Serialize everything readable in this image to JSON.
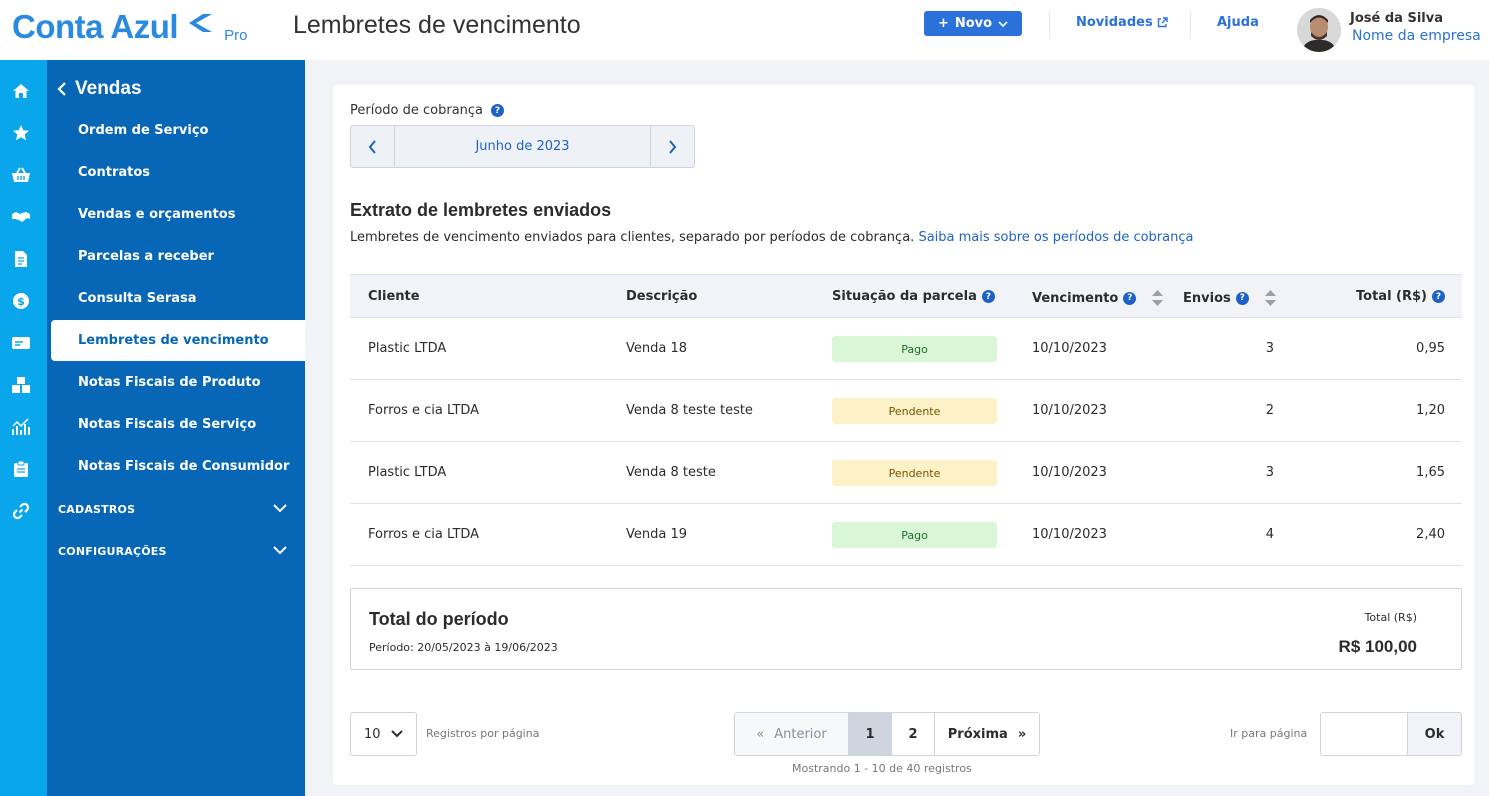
{
  "brand": {
    "name": "Conta Azul",
    "tier": "Pro"
  },
  "header": {
    "title": "Lembretes de vencimento",
    "new_button": "Novo",
    "news_link": "Novidades",
    "help_link": "Ajuda",
    "user_name": "José da Silva",
    "company_name": "Nome da empresa"
  },
  "rail": {
    "icons": [
      "home-icon",
      "star-icon",
      "basket-icon",
      "handshake-icon",
      "document-icon",
      "dollar-icon",
      "card-icon",
      "boxes-icon",
      "chart-icon",
      "clipboard-icon",
      "link-icon"
    ]
  },
  "sidebar": {
    "back_label": "Vendas",
    "items": [
      "Ordem de Serviço",
      "Contratos",
      "Vendas e orçamentos",
      "Parcelas a receber",
      "Consulta Serasa",
      "Lembretes de vencimento",
      "Notas Fiscais de Produto",
      "Notas Fiscais de Serviço",
      "Notas Fiscais de Consumidor"
    ],
    "active_index": 5,
    "sections": [
      "CADASTROS",
      "CONFIGURAÇÕES"
    ]
  },
  "period": {
    "label": "Período de cobrança",
    "value": "Junho de 2023"
  },
  "statement": {
    "title": "Extrato de lembretes enviados",
    "description": "Lembretes de vencimento enviados para clientes, separado por períodos de cobrança.",
    "link": "Saiba mais sobre os períodos de cobrança"
  },
  "table": {
    "columns": [
      "Cliente",
      "Descrição",
      "Situação da parcela",
      "Vencimento",
      "Envios",
      "Total (R$)"
    ],
    "rows": [
      {
        "cliente": "Plastic LTDA",
        "descricao": "Venda 18",
        "situacao": "Pago",
        "vencimento": "10/10/2023",
        "envios": "3",
        "total": "0,95"
      },
      {
        "cliente": "Forros e cia LTDA",
        "descricao": "Venda 8 teste teste",
        "situacao": "Pendente",
        "vencimento": "10/10/2023",
        "envios": "2",
        "total": "1,20"
      },
      {
        "cliente": "Plastic LTDA",
        "descricao": "Venda 8 teste",
        "situacao": "Pendente",
        "vencimento": "10/10/2023",
        "envios": "3",
        "total": "1,65"
      },
      {
        "cliente": "Forros e cia LTDA",
        "descricao": "Venda 19",
        "situacao": "Pago",
        "vencimento": "10/10/2023",
        "envios": "4",
        "total": "2,40"
      }
    ]
  },
  "total": {
    "title": "Total do período",
    "period": "Período: 20/05/2023 à 19/06/2023",
    "label": "Total (R$)",
    "value": "R$ 100,00"
  },
  "pagination": {
    "per_page": "10",
    "per_page_label": "Registros por página",
    "prev": "Anterior",
    "pages": [
      "1",
      "2"
    ],
    "current": "1",
    "next": "Próxima",
    "showing": "Mostrando 1 - 10 de 40 registros",
    "goto_label": "Ir para página",
    "ok": "Ok"
  },
  "colors": {
    "primary": "#2a71d9",
    "sidebar": "#0766b5",
    "rail": "#0aa6ec",
    "paid": "#d9f7d7",
    "pending": "#fdf1c8"
  }
}
